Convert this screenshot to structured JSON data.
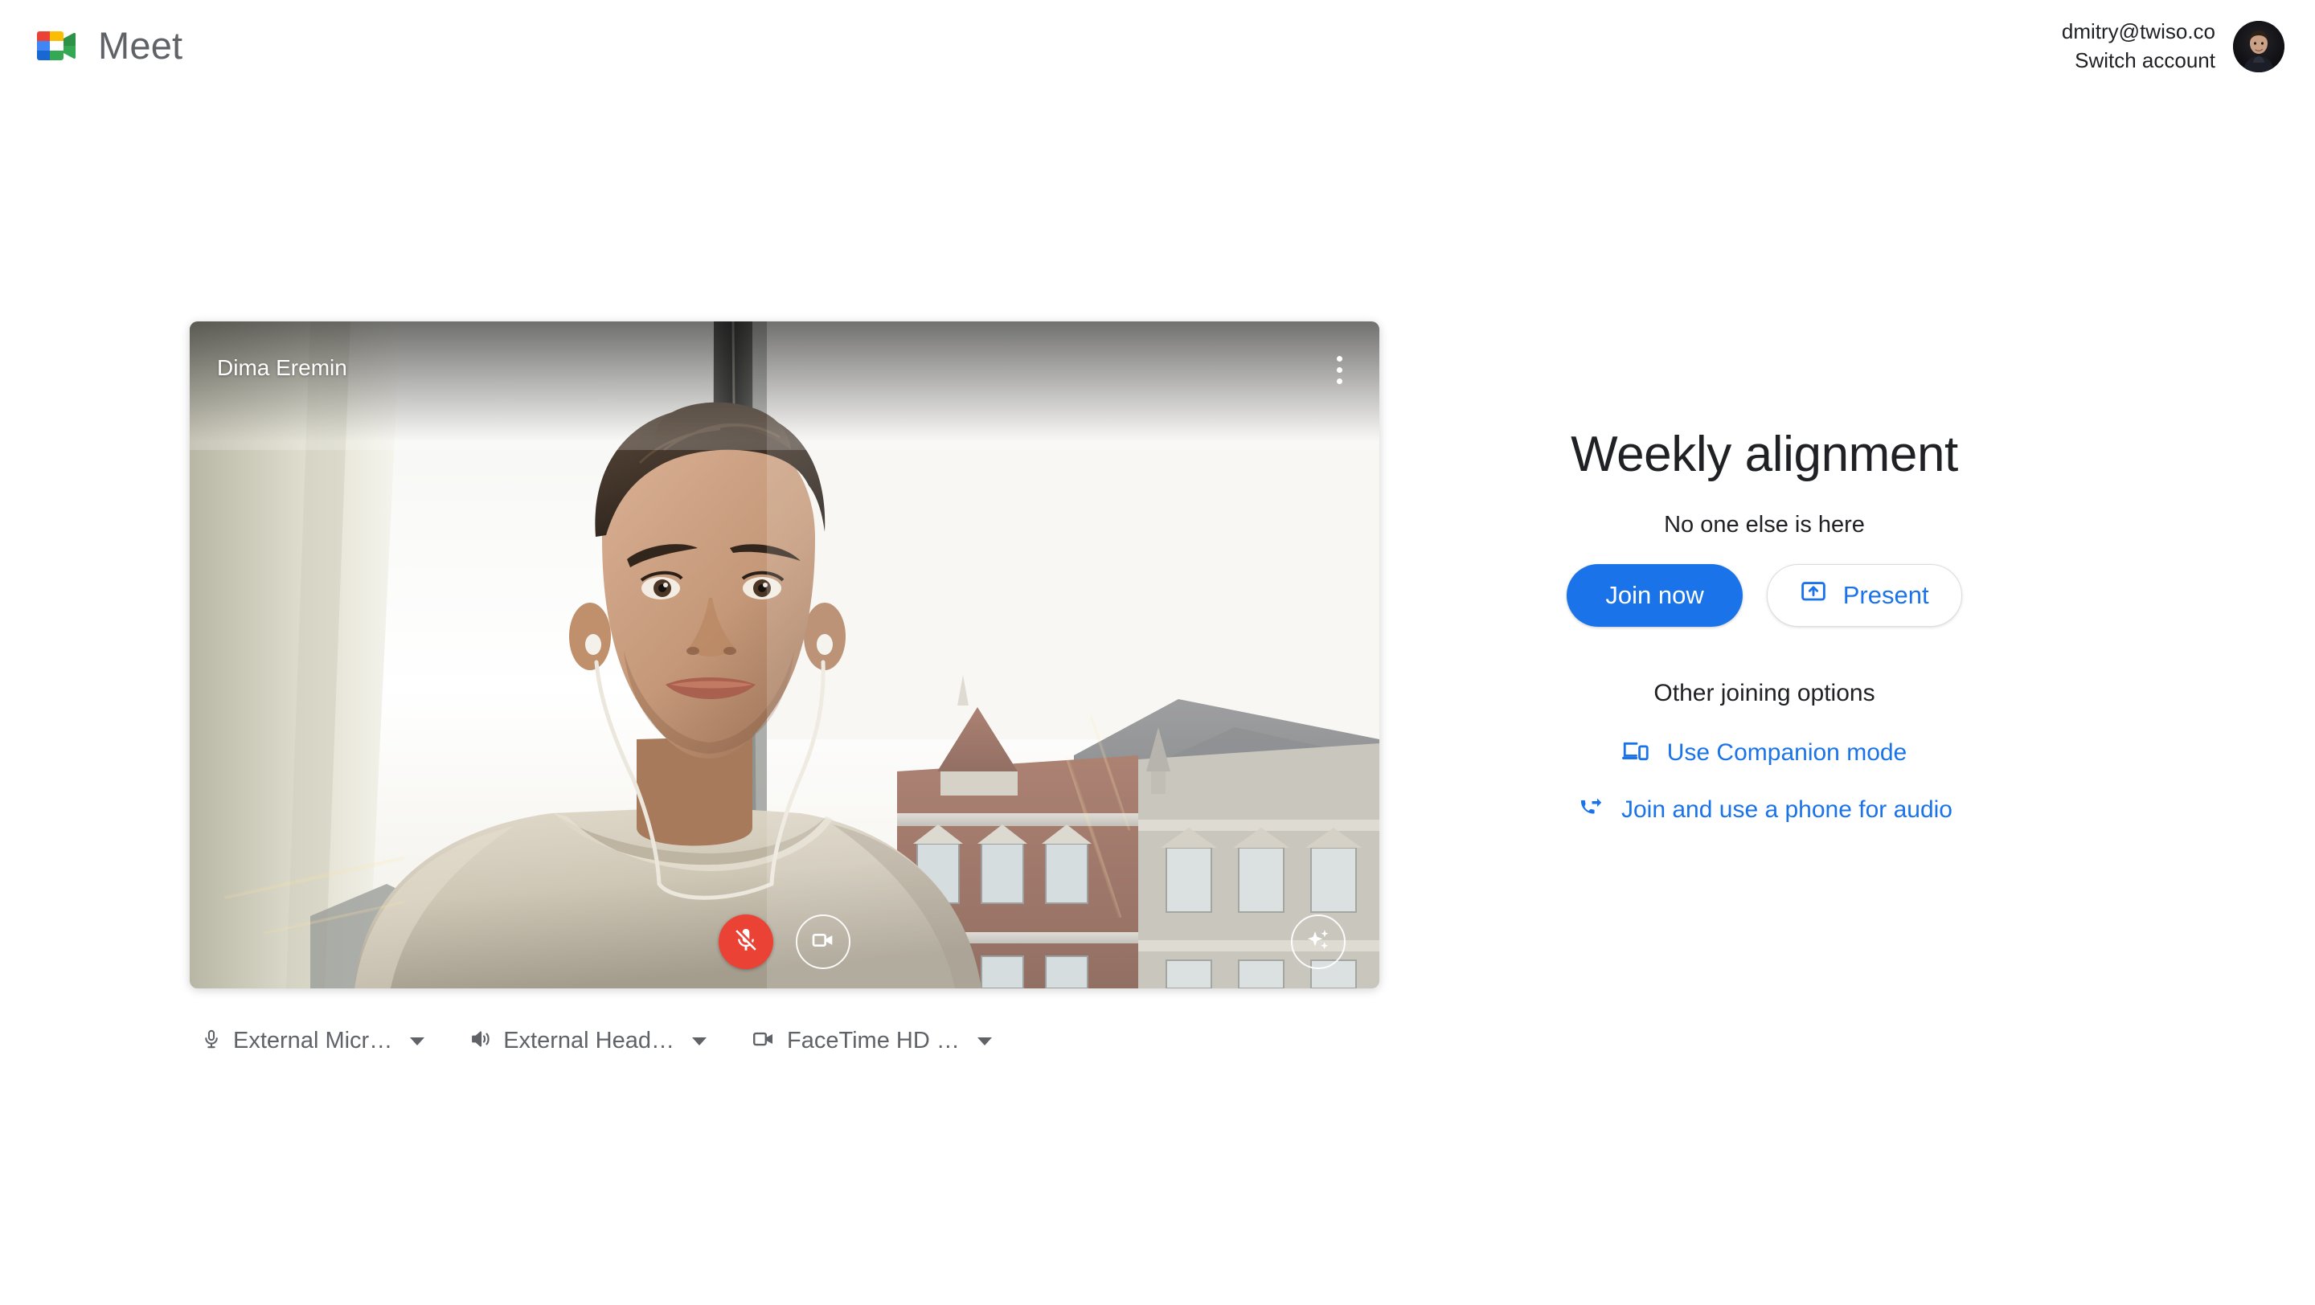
{
  "header": {
    "brand_name": "Meet",
    "logo_icon": "google-meet-logo",
    "account": {
      "email": "dmitry@twiso.co",
      "switch_label": "Switch account",
      "avatar_icon": "user-avatar"
    }
  },
  "preview": {
    "participant_name": "Dima Eremin",
    "more_options_icon": "more-vert-icon",
    "controls": [
      {
        "name": "microphone-toggle",
        "icon": "mic-off-icon",
        "state": "muted",
        "style": "filled-red"
      },
      {
        "name": "camera-toggle",
        "icon": "videocam-icon",
        "state": "on",
        "style": "outlined"
      }
    ],
    "effects": {
      "name": "visual-effects-button",
      "icon": "sparkles-icon",
      "style": "outlined"
    }
  },
  "devices": [
    {
      "icon": "mic-icon",
      "label": "External Micr…",
      "type": "microphone"
    },
    {
      "icon": "speaker-icon",
      "label": "External Head…",
      "type": "speaker"
    },
    {
      "icon": "videocam-icon",
      "label": "FaceTime HD …",
      "type": "camera"
    }
  ],
  "panel": {
    "meeting_title": "Weekly alignment",
    "presence_text": "No one else is here",
    "join_label": "Join now",
    "present_label": "Present",
    "present_icon": "present-to-all-icon",
    "other_options_title": "Other joining options",
    "options": [
      {
        "icon": "companion-devices-icon",
        "label": "Use Companion mode"
      },
      {
        "icon": "phone-forwarded-icon",
        "label": "Join and use a phone for audio"
      }
    ]
  },
  "colors": {
    "accent_blue": "#1a73e8",
    "mic_off_red": "#ea4335",
    "text_primary": "#202124",
    "text_secondary": "#5f6368",
    "border": "#dadce0",
    "background": "#ffffff",
    "logo_blue": "#1a73e8",
    "logo_green": "#34a853",
    "logo_yellow": "#fbbc04",
    "logo_red": "#ea4335"
  }
}
